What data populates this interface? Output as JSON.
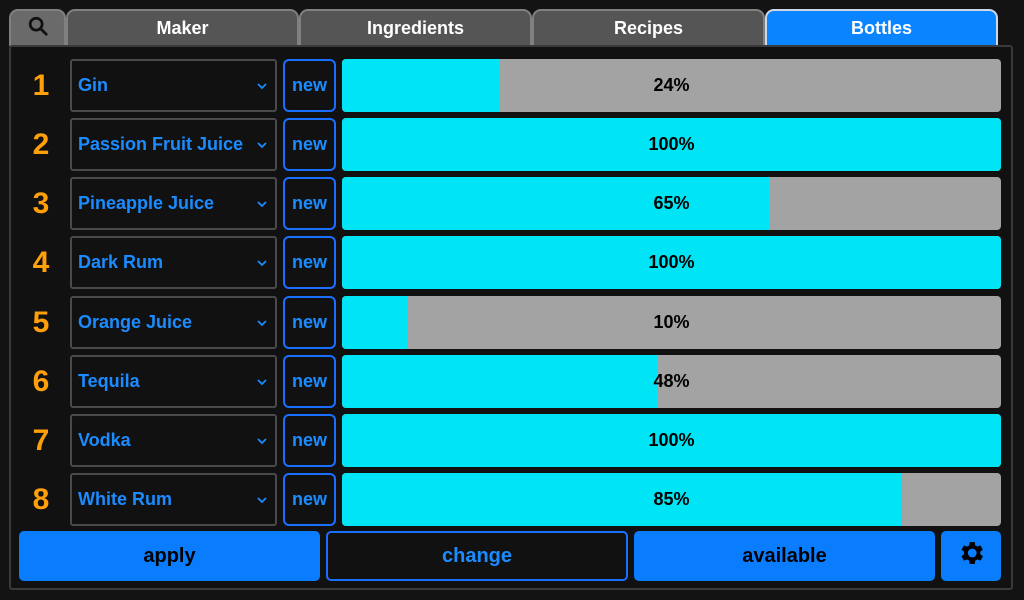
{
  "tabs": [
    {
      "label": "Maker"
    },
    {
      "label": "Ingredients"
    },
    {
      "label": "Recipes"
    },
    {
      "label": "Bottles",
      "active": true
    }
  ],
  "new_label": "new",
  "bottles": [
    {
      "number": "1",
      "ingredient": "Gin",
      "level": 24,
      "level_label": "24%"
    },
    {
      "number": "2",
      "ingredient": "Passion Fruit Juice",
      "level": 100,
      "level_label": "100%"
    },
    {
      "number": "3",
      "ingredient": "Pineapple Juice",
      "level": 65,
      "level_label": "65%"
    },
    {
      "number": "4",
      "ingredient": "Dark Rum",
      "level": 100,
      "level_label": "100%"
    },
    {
      "number": "5",
      "ingredient": "Orange Juice",
      "level": 10,
      "level_label": "10%"
    },
    {
      "number": "6",
      "ingredient": "Tequila",
      "level": 48,
      "level_label": "48%"
    },
    {
      "number": "7",
      "ingredient": "Vodka",
      "level": 100,
      "level_label": "100%"
    },
    {
      "number": "8",
      "ingredient": "White Rum",
      "level": 85,
      "level_label": "85%"
    }
  ],
  "actions": {
    "apply_label": "apply",
    "change_label": "change",
    "available_label": "available"
  },
  "icons": {
    "search": "search-icon",
    "settings": "gear-icon",
    "dropdown": "chevron-down-icon"
  },
  "colors": {
    "accent": "#0a84ff",
    "level_fill": "#00e5f5",
    "level_empty": "#a3a3a3",
    "row_number": "#ff9f0a"
  }
}
